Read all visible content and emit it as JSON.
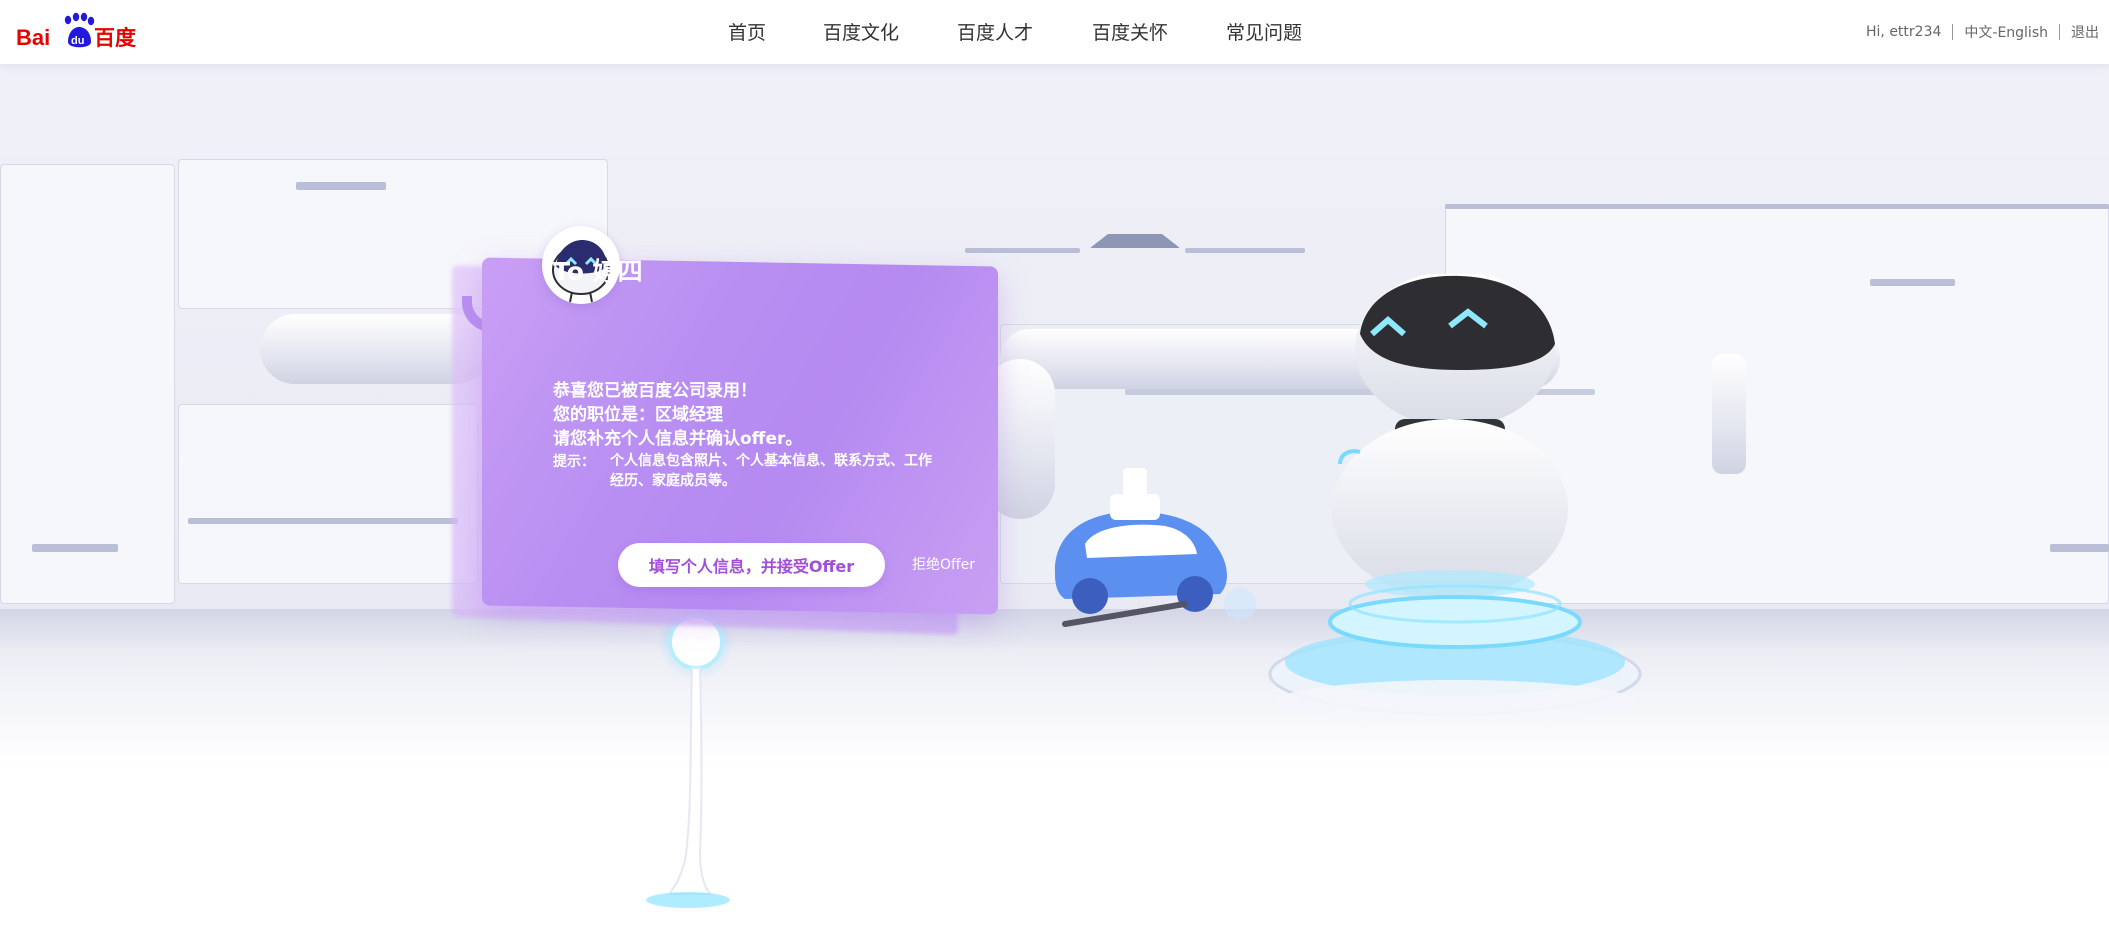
{
  "header": {
    "logo": {
      "part1": "Bai",
      "part2": "du",
      "part3": "百度"
    },
    "nav": [
      {
        "label": "首页"
      },
      {
        "label": "百度文化"
      },
      {
        "label": "百度人才"
      },
      {
        "label": "百度关怀"
      },
      {
        "label": "常见问题"
      }
    ],
    "user": {
      "greeting": "Hi, ettr234",
      "language": "中文-English",
      "logout": "退出"
    }
  },
  "offer_card": {
    "title": "To 婷四",
    "lines": [
      "恭喜您已被百度公司录用！",
      "您的职位是：区域经理",
      "请您补充个人信息并确认offer。"
    ],
    "tip_label": "提示：",
    "tip_text": "个人信息包含照片、个人基本信息、联系方式、工作经历、家庭成员等。",
    "accept_button": "填写个人信息，并接受Offer",
    "reject_link": "拒绝Offer"
  },
  "colors": {
    "card": "#b98ff2",
    "accent_text": "#a14fd8",
    "logo_red": "#e10601",
    "logo_blue": "#2319dc",
    "robot_glow": "#6fd6ff"
  }
}
